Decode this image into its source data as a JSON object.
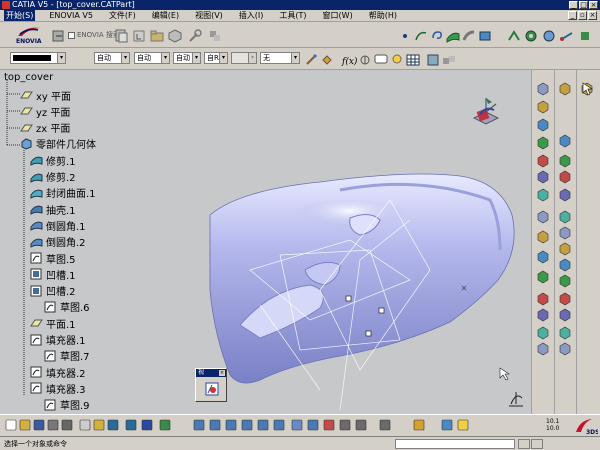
{
  "titlebar": {
    "title": "CATIA V5 - [top_cover.CATPart]"
  },
  "menubar": {
    "items": [
      "开始(S)",
      "ENOVIA V5",
      "文件(F)",
      "编辑(E)",
      "视图(V)",
      "插入(I)",
      "工具(T)",
      "窗口(W)",
      "帮助(H)"
    ]
  },
  "toolbar1": {
    "logo_text": "ENOVIA",
    "enovia_checkbox_label": "ENOVIA 搜索"
  },
  "toolbar2": {
    "color_value": "",
    "linetype_value": "自动",
    "thickness_value": "自动",
    "layer_value": "自动",
    "style_value": "自R",
    "disabled_value": "",
    "none_value": "无"
  },
  "tree": {
    "root": "top_cover",
    "items": [
      {
        "label": "xy 平面",
        "icon": "plane-icon"
      },
      {
        "label": "yz 平面",
        "icon": "plane-icon"
      },
      {
        "label": "zx 平面",
        "icon": "plane-icon"
      },
      {
        "label": "零部件几何体",
        "icon": "body-icon"
      },
      {
        "label": "修剪.1",
        "icon": "trim-icon"
      },
      {
        "label": "修剪.2",
        "icon": "trim-icon"
      },
      {
        "label": "封闭曲面.1",
        "icon": "close-surface-icon"
      },
      {
        "label": "抽壳.1",
        "icon": "shell-icon"
      },
      {
        "label": "倒圆角.1",
        "icon": "fillet-icon"
      },
      {
        "label": "倒圆角.2",
        "icon": "fillet-icon"
      },
      {
        "label": "草图.5",
        "icon": "sketch-icon"
      },
      {
        "label": "凹槽.1",
        "icon": "pocket-icon"
      },
      {
        "label": "凹槽.2",
        "icon": "pocket-icon"
      },
      {
        "label": "草图.6",
        "icon": "sketch-icon"
      },
      {
        "label": "平面.1",
        "icon": "plane-icon"
      },
      {
        "label": "填充器.1",
        "icon": "filler-icon"
      },
      {
        "label": "草图.7",
        "icon": "sketch-icon"
      },
      {
        "label": "填充器.2",
        "icon": "filler-icon"
      },
      {
        "label": "填充器.3",
        "icon": "filler-icon"
      },
      {
        "label": "草图.9",
        "icon": "sketch-icon"
      }
    ]
  },
  "mini_toolbar": {
    "title": "视"
  },
  "bottom_toolbar": {
    "scale_top": "10.1",
    "scale_bottom": "10.0"
  },
  "statusbar": {
    "text": "选择一个对象或命令"
  },
  "colors": {
    "title_bg": "#0a246a",
    "panel_bg": "#d4d0c8",
    "viewport_bg": "#c6c8ca",
    "part_color": "#a8aee6"
  }
}
